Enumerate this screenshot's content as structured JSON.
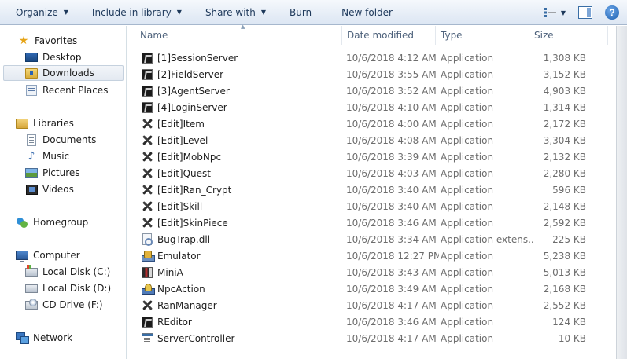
{
  "toolbar": {
    "organize": "Organize",
    "include_in_library": "Include in library",
    "share_with": "Share with",
    "burn": "Burn",
    "new_folder": "New folder"
  },
  "nav": {
    "favorites": "Favorites",
    "desktop": "Desktop",
    "downloads": "Downloads",
    "recent_places": "Recent Places",
    "libraries": "Libraries",
    "documents": "Documents",
    "music": "Music",
    "pictures": "Pictures",
    "videos": "Videos",
    "homegroup": "Homegroup",
    "computer": "Computer",
    "local_disk_c": "Local Disk (C:)",
    "local_disk_d": "Local Disk (D:)",
    "cd_drive": "CD Drive (F:)",
    "network": "Network"
  },
  "columns": {
    "name": "Name",
    "date_modified": "Date modified",
    "type": "Type",
    "size": "Size"
  },
  "files": [
    {
      "name": "[1]SessionServer",
      "date": "10/6/2018 4:12 AM",
      "type": "Application",
      "size": "1,308 KB",
      "icon": "server-app-icon"
    },
    {
      "name": "[2]FieldServer",
      "date": "10/6/2018 3:55 AM",
      "type": "Application",
      "size": "3,152 KB",
      "icon": "server-app-icon"
    },
    {
      "name": "[3]AgentServer",
      "date": "10/6/2018 3:52 AM",
      "type": "Application",
      "size": "4,903 KB",
      "icon": "server-app-icon"
    },
    {
      "name": "[4]LoginServer",
      "date": "10/6/2018 4:10 AM",
      "type": "Application",
      "size": "1,314 KB",
      "icon": "server-app-icon"
    },
    {
      "name": "[Edit]Item",
      "date": "10/6/2018 4:00 AM",
      "type": "Application",
      "size": "2,172 KB",
      "icon": "tools-icon"
    },
    {
      "name": "[Edit]Level",
      "date": "10/6/2018 4:08 AM",
      "type": "Application",
      "size": "3,304 KB",
      "icon": "tools-icon"
    },
    {
      "name": "[Edit]MobNpc",
      "date": "10/6/2018 3:39 AM",
      "type": "Application",
      "size": "2,132 KB",
      "icon": "tools-icon"
    },
    {
      "name": "[Edit]Quest",
      "date": "10/6/2018 4:03 AM",
      "type": "Application",
      "size": "2,280 KB",
      "icon": "tools-icon"
    },
    {
      "name": "[Edit]Ran_Crypt",
      "date": "10/6/2018 3:40 AM",
      "type": "Application",
      "size": "596 KB",
      "icon": "tools-icon"
    },
    {
      "name": "[Edit]Skill",
      "date": "10/6/2018 3:40 AM",
      "type": "Application",
      "size": "2,148 KB",
      "icon": "tools-icon"
    },
    {
      "name": "[Edit]SkinPiece",
      "date": "10/6/2018 3:46 AM",
      "type": "Application",
      "size": "2,592 KB",
      "icon": "tools-icon"
    },
    {
      "name": "BugTrap.dll",
      "date": "10/6/2018 3:34 AM",
      "type": "Application extens...",
      "size": "225 KB",
      "icon": "dll-icon"
    },
    {
      "name": "Emulator",
      "date": "10/6/2018 12:27 PM",
      "type": "Application",
      "size": "5,238 KB",
      "icon": "emulator-icon"
    },
    {
      "name": "MiniA",
      "date": "10/6/2018 3:43 AM",
      "type": "Application",
      "size": "5,013 KB",
      "icon": "minia-icon"
    },
    {
      "name": "NpcAction",
      "date": "10/6/2018 3:49 AM",
      "type": "Application",
      "size": "2,168 KB",
      "icon": "npc-icon"
    },
    {
      "name": "RanManager",
      "date": "10/6/2018 4:17 AM",
      "type": "Application",
      "size": "2,552 KB",
      "icon": "tools-icon"
    },
    {
      "name": "REditor",
      "date": "10/6/2018 3:46 AM",
      "type": "Application",
      "size": "124 KB",
      "icon": "server-app-icon"
    },
    {
      "name": "ServerController",
      "date": "10/6/2018 4:17 AM",
      "type": "Application",
      "size": "10 KB",
      "icon": "window-app-icon"
    }
  ]
}
